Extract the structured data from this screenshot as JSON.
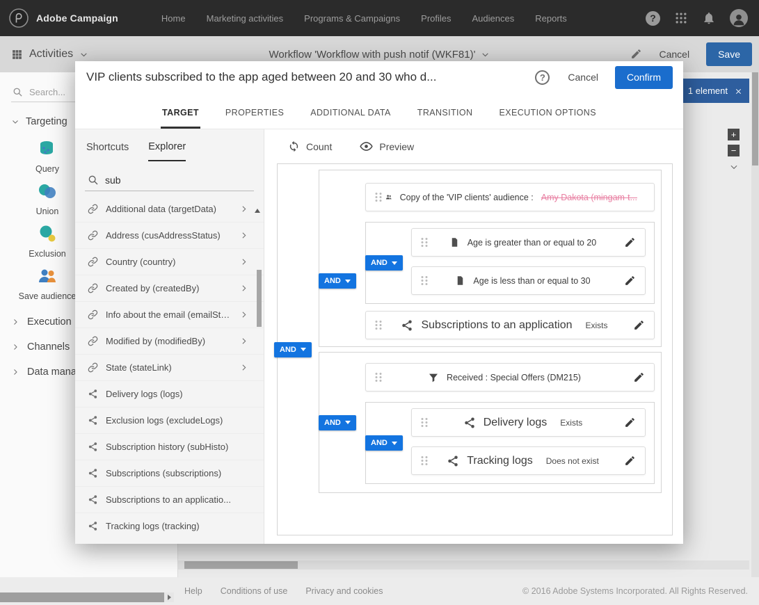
{
  "topbar": {
    "brand": "Adobe Campaign",
    "nav": [
      {
        "label": "Home"
      },
      {
        "label": "Marketing activities"
      },
      {
        "label": "Programs & Campaigns"
      },
      {
        "label": "Profiles"
      },
      {
        "label": "Audiences"
      },
      {
        "label": "Reports"
      }
    ],
    "help": "?"
  },
  "toolbar": {
    "context_label": "Activities",
    "workflow_title": "Workflow 'Workflow with push notif (WKF81)'",
    "cancel_label": "Cancel",
    "save_label": "Save"
  },
  "sidebar": {
    "search_placeholder": "Search...",
    "targeting": {
      "label": "Targeting",
      "items": [
        {
          "label": "Query",
          "icon": "query-icon"
        },
        {
          "label": "Union",
          "icon": "union-icon"
        },
        {
          "label": "Exclusion",
          "icon": "exclusion-icon"
        },
        {
          "label": "Save audience",
          "icon": "save-audience-icon"
        }
      ]
    },
    "sections": [
      {
        "label": "Execution"
      },
      {
        "label": "Channels"
      },
      {
        "label": "Data management"
      }
    ]
  },
  "canvas": {
    "selection_label": "1 element",
    "zoom_in": "+",
    "zoom_out": "−"
  },
  "modal": {
    "title": "VIP clients subscribed to the app aged between 20 and 30 who d...",
    "help": "?",
    "cancel_label": "Cancel",
    "confirm_label": "Confirm",
    "tabs": [
      {
        "label": "TARGET"
      },
      {
        "label": "PROPERTIES"
      },
      {
        "label": "ADDITIONAL DATA"
      },
      {
        "label": "TRANSITION"
      },
      {
        "label": "EXECUTION OPTIONS"
      }
    ],
    "active_tab": "TARGET",
    "explorer": {
      "tabs": [
        {
          "label": "Shortcuts"
        },
        {
          "label": "Explorer"
        }
      ],
      "active_tab": "Explorer",
      "search_value": "sub",
      "items": [
        {
          "label": "Additional data (targetData)",
          "icon": "link-icon",
          "expandable": true
        },
        {
          "label": "Address (cusAddressStatus)",
          "icon": "link-icon",
          "expandable": true
        },
        {
          "label": "Country (country)",
          "icon": "link-icon",
          "expandable": true
        },
        {
          "label": "Created by (createdBy)",
          "icon": "link-icon",
          "expandable": true
        },
        {
          "label": "Info about the email (emailSta...",
          "icon": "link-icon",
          "expandable": true
        },
        {
          "label": "Modified by (modifiedBy)",
          "icon": "link-icon",
          "expandable": true
        },
        {
          "label": "State (stateLink)",
          "icon": "link-icon",
          "expandable": true
        },
        {
          "label": "Delivery logs (logs)",
          "icon": "collection-icon",
          "expandable": false
        },
        {
          "label": "Exclusion logs (excludeLogs)",
          "icon": "collection-icon",
          "expandable": false
        },
        {
          "label": "Subscription history (subHisto)",
          "icon": "collection-icon",
          "expandable": false
        },
        {
          "label": "Subscriptions (subscriptions)",
          "icon": "collection-icon",
          "expandable": false
        },
        {
          "label": "Subscriptions to an applicatio...",
          "icon": "collection-icon",
          "expandable": false
        },
        {
          "label": "Tracking logs (tracking)",
          "icon": "collection-icon",
          "expandable": false
        }
      ]
    },
    "query": {
      "count_label": "Count",
      "preview_label": "Preview",
      "operator_label": "AND",
      "groupA": {
        "audience": {
          "icon": "audience-icon",
          "label": "Copy of the 'VIP clients' audience :",
          "redacted": "Amy Dakota (mingam-t..."
        },
        "age_group": {
          "conditions": [
            {
              "icon": "document-icon",
              "label": "Age is greater than or equal to 20"
            },
            {
              "icon": "document-icon",
              "label": "Age is less than or equal to 30"
            }
          ]
        },
        "subscription": {
          "icon": "collection-icon",
          "label": "Subscriptions to an application",
          "qualifier": "Exists"
        }
      },
      "groupB": {
        "received": {
          "icon": "filter-icon",
          "label": "Received : Special Offers (DM215)"
        },
        "logs_group": {
          "conditions": [
            {
              "icon": "collection-icon",
              "label": "Delivery logs",
              "qualifier": "Exists"
            },
            {
              "icon": "collection-icon",
              "label": "Tracking logs",
              "qualifier": "Does not exist"
            }
          ]
        }
      }
    }
  },
  "footer": {
    "links": [
      {
        "label": "Help"
      },
      {
        "label": "Conditions of use"
      },
      {
        "label": "Privacy and cookies"
      }
    ],
    "copyright": "© 2016 Adobe Systems Incorporated. All Rights Reserved."
  }
}
